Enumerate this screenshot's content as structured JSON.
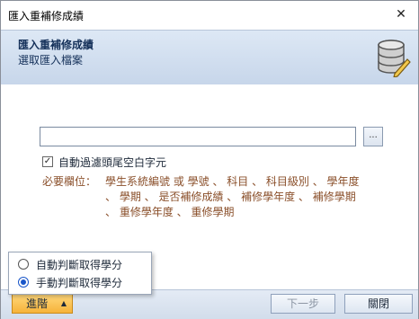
{
  "window": {
    "title": "匯入重補修成績"
  },
  "header": {
    "title": "匯入重補修成績",
    "subtitle": "選取匯入檔案",
    "icon": "database-icon"
  },
  "file": {
    "value": "",
    "browse_label": "..."
  },
  "option": {
    "trim_label": "自動過濾頭尾空白字元",
    "trim_checked": true
  },
  "required": {
    "label": "必要欄位：",
    "lines": [
      "學生系統編號 或 學號 、 科目 、 科目級別 、 學年度",
      "、 學期 、 是否補修成績 、 補修學年度 、 補修學期",
      "、 重修學年度 、 重修學期"
    ]
  },
  "advanced_menu": {
    "options": [
      {
        "label": "自動判斷取得學分",
        "selected": false
      },
      {
        "label": "手動判斷取得學分",
        "selected": true
      }
    ]
  },
  "footer": {
    "advanced_label": "進階",
    "next_label": "下一步",
    "close_label": "關閉"
  },
  "colors": {
    "accent": "#f6b33a",
    "required_text": "#8a4f2a",
    "header_bg": "#c7d6ea"
  }
}
